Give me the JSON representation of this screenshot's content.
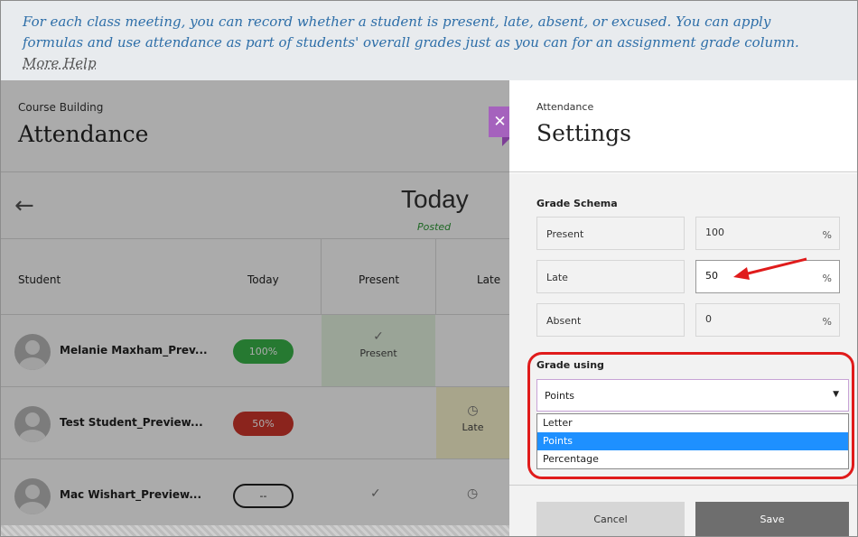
{
  "banner": {
    "text": "For each class meeting, you can record whether a student is present, late, absent, or excused. You can apply formulas and use attendance as part of students' overall grades just as you can for an assignment grade column.",
    "help_link": "More Help"
  },
  "course": {
    "breadcrumb": "Course Building",
    "title": "Attendance",
    "day_label": "Today",
    "day_status": "Posted",
    "columns": [
      "Student",
      "Today",
      "Present",
      "Late"
    ],
    "rows": [
      {
        "name": "Melanie Maxham_Prev...",
        "score": "100%",
        "present": "Present"
      },
      {
        "name": "Test Student_Preview...",
        "score": "50%",
        "late": "Late"
      },
      {
        "name": "Mac Wishart_Preview...",
        "score": "--"
      }
    ]
  },
  "icons": {
    "back": "left-arrow-icon",
    "close": "close-icon",
    "check": "checkmark-icon",
    "clock": "clock-icon",
    "caret": "caret-down-icon",
    "avatar": "user-avatar-icon"
  },
  "panel": {
    "breadcrumb": "Attendance",
    "title": "Settings",
    "schema_title": "Grade Schema",
    "schema": [
      {
        "label": "Present",
        "value": "100",
        "unit": "%"
      },
      {
        "label": "Late",
        "value": "50",
        "unit": "%"
      },
      {
        "label": "Absent",
        "value": "0",
        "unit": "%"
      }
    ],
    "grade_using_label": "Grade using",
    "grade_using_value": "Points",
    "grade_options": [
      "Letter",
      "Points",
      "Percentage"
    ],
    "cancel_label": "Cancel",
    "save_label": "Save"
  },
  "colors": {
    "accent": "#a562bd",
    "annotation": "#e01b1b",
    "present_green": "#3ab54a",
    "late_red": "#d0362c",
    "link_blue": "#2d6ea8",
    "selected_option": "#1e90ff"
  }
}
